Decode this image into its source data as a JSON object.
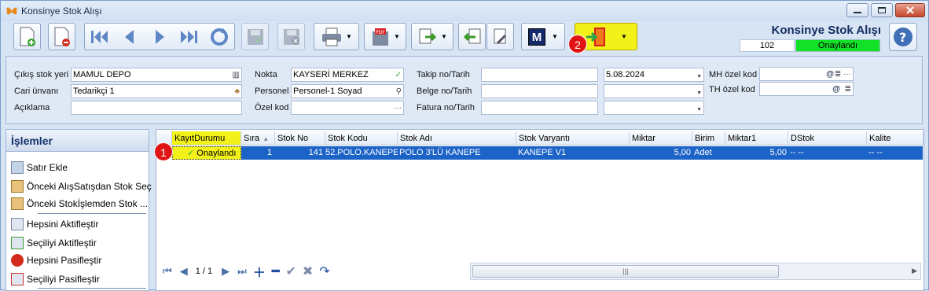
{
  "window": {
    "title": "Konsinye Stok Alışı"
  },
  "header": {
    "title": "Konsinye Stok Alışı",
    "number": "102",
    "status": "Onaylandı",
    "status_color": "#12e227"
  },
  "toolbar": {
    "buttons": [
      "new-doc-icon",
      "delete-doc-icon",
      "first-icon",
      "prev-icon",
      "next-icon",
      "last-icon",
      "refresh-icon",
      "save-icon",
      "cancel-save-icon",
      "print-icon",
      "pdf-icon",
      "export-icon",
      "import-icon",
      "tools-icon",
      "m-icon",
      "exit-icon"
    ],
    "m_label": "M"
  },
  "form": {
    "cikis_stok_yeri": {
      "label": "Çıkış stok yeri",
      "value": "MAMUL DEPO"
    },
    "cari_unvani": {
      "label": "Cari ünvanı",
      "value": "Tedarikçi 1"
    },
    "aciklama": {
      "label": "Açıklama",
      "value": ""
    },
    "nokta": {
      "label": "Nokta",
      "value": "KAYSERİ MERKEZ"
    },
    "personel": {
      "label": "Personel",
      "value": "Personel-1 Soyad"
    },
    "ozel_kod": {
      "label": "Özel kod",
      "value": ""
    },
    "takip": {
      "label": "Takip no/Tarih",
      "value": "",
      "date": "5.08.2024"
    },
    "belge": {
      "label": "Belge no/Tarih",
      "value": "",
      "date": ""
    },
    "fatura": {
      "label": "Fatura no/Tarih",
      "value": "",
      "date": ""
    },
    "mh_ozel_kod": {
      "label": "MH özel kod",
      "value": ""
    },
    "th_ozel_kod": {
      "label": "TH özel kod",
      "value": ""
    }
  },
  "islemler": {
    "title": "İşlemler",
    "items": [
      "Satır Ekle",
      "Önceki AlışSatışdan Stok Seç",
      "Önceki Stokİşlemden Stok ...",
      "Hepsini Aktifleştir",
      "Seçiliyi Aktifleştir",
      "Hepsini Pasifleştir",
      "Seçiliyi Pasifleştir"
    ]
  },
  "grid": {
    "columns": [
      "KayıtDurumu",
      "Sıra",
      "Stok No",
      "Stok Kodu",
      "Stok Adı",
      "Stok Varyantı",
      "Miktar",
      "Birim",
      "Miktar1",
      "DStok",
      "Kalite"
    ],
    "rows": [
      {
        "durum": "Onaylandı",
        "sira": "1",
        "stok_no": "141",
        "stok_kodu": "52.POLO.KANEPE",
        "stok_adi": "POLO 3'LÜ KANEPE",
        "varyant": "KANEPE V1",
        "miktar": "5,00",
        "birim": "Adet",
        "miktar1": "5,00",
        "dstok": "-- --",
        "kalite": "-- --"
      }
    ],
    "pager": "1 / 1"
  },
  "badges": [
    "1",
    "2"
  ],
  "colors": {
    "selection": "#1c63c7",
    "highlight": "#f2f21a",
    "badge": "#e01414"
  }
}
